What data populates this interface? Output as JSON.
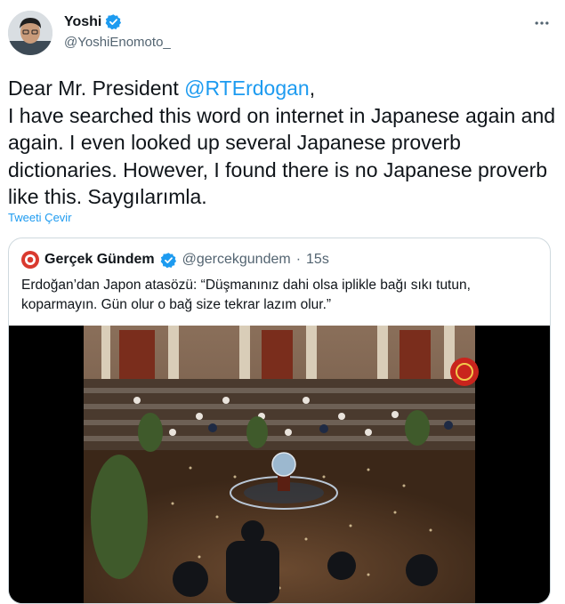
{
  "author": {
    "display_name": "Yoshi",
    "handle": "@YoshiEnomoto_",
    "verified": true
  },
  "tweet": {
    "text_before_mention": "Dear Mr. President ",
    "mention": "@RTErdogan",
    "text_after_mention": ",\nI have searched this word on internet in Japanese again and again. I even looked up several Japanese proverb dictionaries. However, I found there is no Japanese proverb like this. Saygılarımla.",
    "translate_label": "Tweeti Çevir"
  },
  "quoted_tweet": {
    "display_name": "Gerçek Gündem",
    "handle": "@gercekgundem",
    "separator": "·",
    "time": "15s",
    "verified": true,
    "text": "Erdoğan’dan Japon atasözü: “Düşmanınız dahi olsa iplikle bağı sıkı tutun, koparmayın. Gün olur o bağ size tekrar lazım olur.”"
  },
  "icons": {
    "verified": "verified-badge-icon",
    "more": "more-options-icon"
  },
  "colors": {
    "accent": "#1d9bf0",
    "text": "#0f1419",
    "muted": "#536471",
    "border": "#cfd9de"
  }
}
